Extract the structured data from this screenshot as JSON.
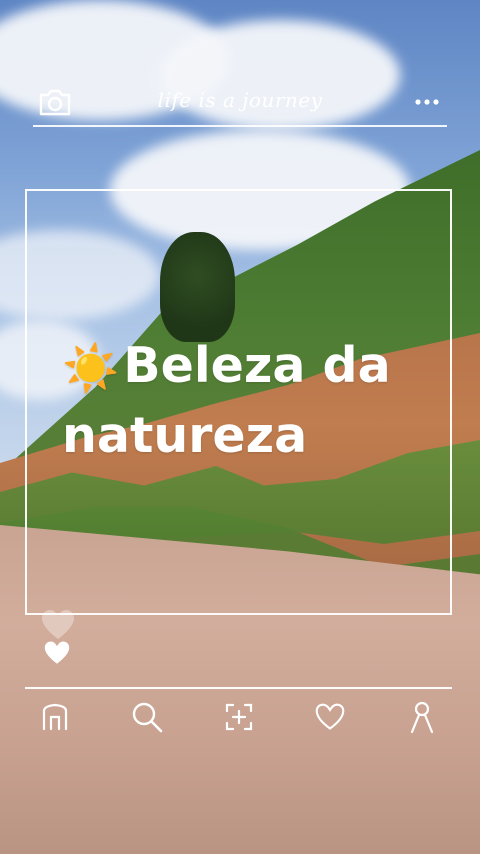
{
  "header": {
    "tagline": "life is a journey",
    "left_icon": "camera-icon",
    "right_icon": "more-dots-icon"
  },
  "post": {
    "sun_emoji": "☀️",
    "caption_line1": "Beleza da",
    "caption_line2": "natureza"
  },
  "reactions": {
    "icons": [
      "heart-outline-icon",
      "heart-filled-icon"
    ]
  },
  "bottom_nav": {
    "items": [
      {
        "icon": "home-icon"
      },
      {
        "icon": "search-icon"
      },
      {
        "icon": "add-post-icon"
      },
      {
        "icon": "heart-icon"
      },
      {
        "icon": "profile-icon"
      }
    ]
  },
  "colors": {
    "overlay": "#ffffff",
    "sky": "#7fa3d6",
    "foliage": "#4d7d33",
    "dirt": "#c07d4f",
    "road": "#d2ad9c"
  }
}
